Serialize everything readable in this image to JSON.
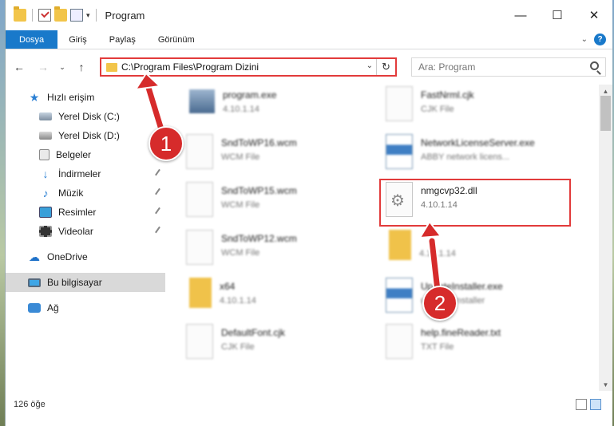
{
  "window": {
    "title": "Program",
    "controls": {
      "minimize": "—",
      "maximize": "☐",
      "close": "✕"
    }
  },
  "ribbon": {
    "tabs": [
      {
        "label": "Dosya",
        "active": true
      },
      {
        "label": "Giriş",
        "active": false
      },
      {
        "label": "Paylaş",
        "active": false
      },
      {
        "label": "Görünüm",
        "active": false
      }
    ],
    "help": "?"
  },
  "navbar": {
    "address": "C:\\Program Files\\Program Dizini",
    "search_placeholder": "Ara: Program"
  },
  "sidebar": {
    "items": [
      {
        "label": "Hızlı erişim",
        "icon": "star-icon"
      },
      {
        "label": "Yerel Disk (C:)",
        "icon": "drive-icon",
        "pinned": true
      },
      {
        "label": "Yerel Disk (D:)",
        "icon": "drive-icon",
        "pinned": true
      },
      {
        "label": "Belgeler",
        "icon": "documents-icon",
        "pinned": true
      },
      {
        "label": "İndirmeler",
        "icon": "download-icon",
        "pinned": true
      },
      {
        "label": "Müzik",
        "icon": "music-icon",
        "pinned": true
      },
      {
        "label": "Resimler",
        "icon": "pictures-icon",
        "pinned": true
      },
      {
        "label": "Videolar",
        "icon": "videos-icon",
        "pinned": true
      },
      {
        "label": "OneDrive",
        "icon": "cloud-icon"
      },
      {
        "label": "Bu bilgisayar",
        "icon": "computer-icon",
        "selected": true
      },
      {
        "label": "Ağ",
        "icon": "network-icon"
      }
    ]
  },
  "files": [
    {
      "name": "program.exe",
      "sub": "4.10.1.14",
      "type": "exe"
    },
    {
      "name": "FastNrml.cjk",
      "sub": "CJK File",
      "type": "doc"
    },
    {
      "name": "SndToWP16.wcm",
      "sub": "WCM File",
      "type": "doc"
    },
    {
      "name": "NetworkLicenseServer.exe",
      "sub": "ABBY network licens...",
      "type": "app"
    },
    {
      "name": "SndToWP15.wcm",
      "sub": "WCM File",
      "type": "doc"
    },
    {
      "name": "nmgcvp32.dll",
      "sub": "4.10.1.14",
      "type": "dll",
      "highlighted": true
    },
    {
      "name": "SndToWP12.wcm",
      "sub": "WCM File",
      "type": "doc"
    },
    {
      "name": "",
      "sub": "4.10.1.14",
      "type": "fold"
    },
    {
      "name": "x64",
      "sub": "4.10.1.14",
      "type": "fold"
    },
    {
      "name": "UpdateInstaller.exe",
      "sub": "updates installer",
      "type": "app"
    },
    {
      "name": "DefaultFont.cjk",
      "sub": "CJK File",
      "type": "doc"
    },
    {
      "name": "help.fineReader.txt",
      "sub": "TXT File",
      "type": "doc"
    }
  ],
  "status": {
    "item_count": "126 öğe"
  },
  "callouts": {
    "first": "1",
    "second": "2"
  },
  "colors": {
    "accent": "#1979ca",
    "highlight": "#e23b3b",
    "callout": "#d62b2b"
  }
}
